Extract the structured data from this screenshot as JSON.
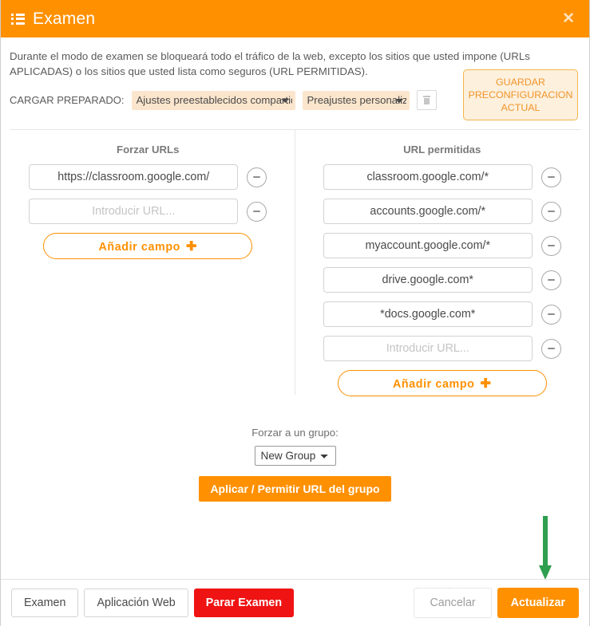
{
  "header": {
    "title": "Examen",
    "menu_icon": "list-icon",
    "close_icon": "close-icon",
    "close_label": "✕",
    "bg_color": "#FF9000"
  },
  "intro": {
    "description": "Durante el modo de examen se bloqueará todo el tráfico de la web, excepto los sitios que usted impone (URLs APLICADAS) o los sitios que usted lista como seguros (URL PERMITIDAS).",
    "preset_label": "CARGAR PREPARADO:",
    "preset_shared_value": "Ajustes preestablecidos compartidos",
    "preset_personal_value": "Preajustes personalizados",
    "delete_icon": "trash-icon",
    "save_preset_label": "GUARDAR PRECONFIGURACION ACTUAL"
  },
  "columns": {
    "forced": {
      "title": "Forzar URLs",
      "rows": [
        {
          "value": "https://classroom.google.com/",
          "placeholder": "Introducir URL...",
          "remove_icon": "minus-circle-icon"
        },
        {
          "value": "",
          "placeholder": "Introducir URL...",
          "remove_icon": "minus-circle-icon"
        }
      ],
      "add_label": "Añadir campo",
      "add_icon": "plus-icon",
      "add_icon_glyph": "✚"
    },
    "allowed": {
      "title": "URL permitidas",
      "rows": [
        {
          "value": "classroom.google.com/*",
          "placeholder": "Introducir URL...",
          "remove_icon": "minus-circle-icon"
        },
        {
          "value": "accounts.google.com/*",
          "placeholder": "Introducir URL...",
          "remove_icon": "minus-circle-icon"
        },
        {
          "value": "myaccount.google.com/*",
          "placeholder": "Introducir URL...",
          "remove_icon": "minus-circle-icon"
        },
        {
          "value": "drive.google.com*",
          "placeholder": "Introducir URL...",
          "remove_icon": "minus-circle-icon"
        },
        {
          "value": "*docs.google.com*",
          "placeholder": "Introducir URL...",
          "remove_icon": "minus-circle-icon"
        },
        {
          "value": "",
          "placeholder": "Introducir URL...",
          "remove_icon": "minus-circle-icon"
        }
      ],
      "add_label": "Añadir campo",
      "add_icon": "plus-icon",
      "add_icon_glyph": "✚"
    }
  },
  "group": {
    "label": "Forzar a un grupo:",
    "selected": "New Group",
    "apply_label": "Aplicar / Permitir URL del grupo"
  },
  "annotation": {
    "arrow_icon": "down-arrow-annotation",
    "arrow_color": "#2E9E4F",
    "points_to": "Actualizar"
  },
  "footer": {
    "exam_label": "Examen",
    "web_app_label": "Aplicación Web",
    "stop_exam_label": "Parar Examen",
    "cancel_label": "Cancelar",
    "update_label": "Actualizar"
  },
  "colors": {
    "accent": "#FF9000",
    "danger": "#EF1313",
    "annotation_green": "#2E9E4F",
    "preset_field": "#FBE6CD"
  }
}
